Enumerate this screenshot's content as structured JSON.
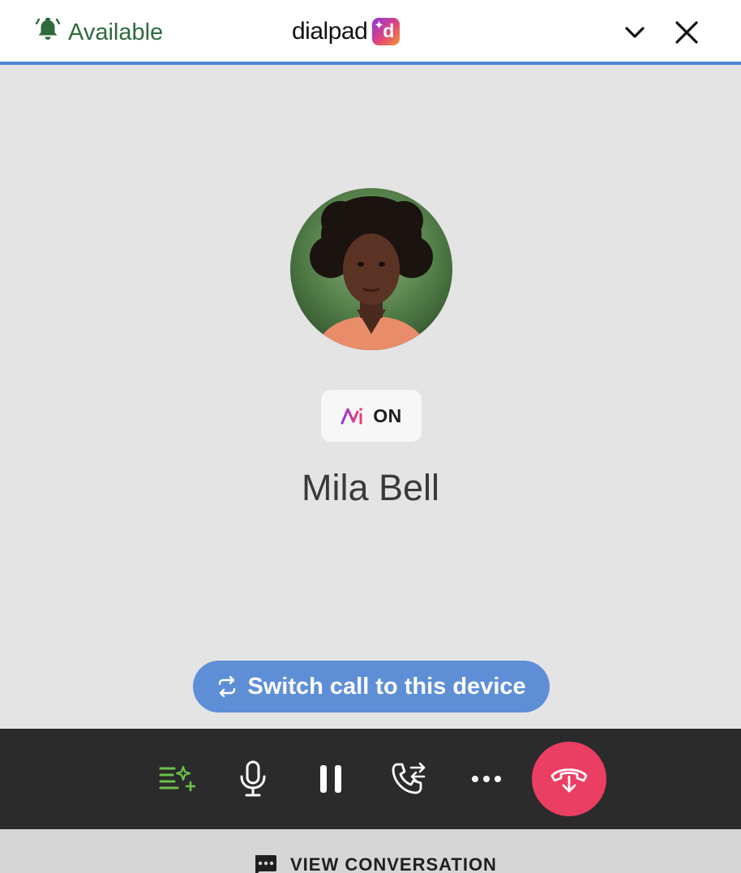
{
  "header": {
    "status_label": "Available",
    "status_color": "#2e6a3c",
    "brand_name": "dialpad",
    "brand_logo_letter": "d",
    "accent_color": "#4a86d8",
    "icons": [
      "alarm-bell-icon",
      "chevron-down-icon",
      "close-icon"
    ]
  },
  "call": {
    "ai_badge_label": "ON",
    "contact_name": "Mila Bell",
    "switch_device_label": "Switch call to this device",
    "switch_button_color": "#5e8fd6"
  },
  "controls": {
    "icons": [
      "ai-notes-icon",
      "microphone-icon",
      "pause-icon",
      "transfer-call-icon",
      "more-icon",
      "hangup-icon"
    ],
    "hangup_color": "#ea3e62",
    "ai_notes_color": "#6cc24a"
  },
  "footer": {
    "view_conversation_label": "VIEW CONVERSATION"
  }
}
